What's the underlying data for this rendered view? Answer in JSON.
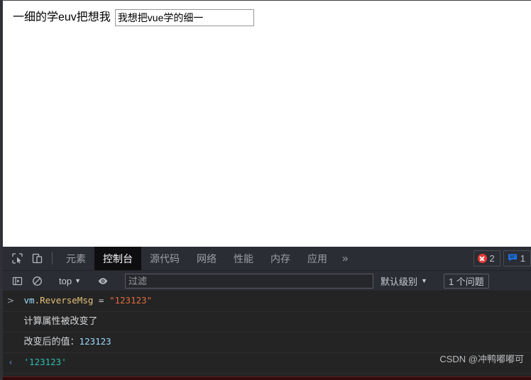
{
  "page": {
    "reversed_text": "一细的学euv把想我",
    "input_value": "我想把vue学的细一",
    "input_placeholder": ""
  },
  "devtools": {
    "icons": {
      "inspect": "inspect-element-icon",
      "device": "device-toolbar-icon",
      "sidebar": "console-sidebar-icon",
      "clear": "clear-console-icon",
      "eye": "live-expression-eye-icon"
    },
    "tabs": [
      {
        "label": "元素",
        "active": false
      },
      {
        "label": "控制台",
        "active": true
      },
      {
        "label": "源代码",
        "active": false
      },
      {
        "label": "网络",
        "active": false
      },
      {
        "label": "性能",
        "active": false
      },
      {
        "label": "内存",
        "active": false
      },
      {
        "label": "应用",
        "active": false
      }
    ],
    "more_tabs_label": "»",
    "badges": {
      "error_count": "2",
      "message_count": "1",
      "error_color": "#e53935",
      "message_color": "#1a73e8"
    },
    "console_toolbar": {
      "context_label": "top",
      "context_caret": "▼",
      "filter_placeholder": "过滤",
      "filter_value": "",
      "levels_label": "默认级别",
      "levels_caret": "▼",
      "issues_label": "1 个问题"
    },
    "console_messages": [
      {
        "gutter": ">",
        "gutter_type": "input",
        "type": "command",
        "tokens": [
          {
            "text": "vm",
            "cls": "tok-obj"
          },
          {
            "text": ".ReverseMsg",
            "cls": "tok-prop"
          },
          {
            "text": " = ",
            "cls": "tok-op"
          },
          {
            "text": "\"123123\"",
            "cls": "tok-str-q"
          }
        ]
      },
      {
        "gutter": "",
        "gutter_type": "none",
        "type": "log",
        "text": "计算属性被改变了"
      },
      {
        "gutter": "",
        "gutter_type": "none",
        "type": "log-mixed",
        "tokens": [
          {
            "text": "改变后的值：",
            "cls": "log-cjk"
          },
          {
            "text": "123123",
            "cls": "tok-num"
          }
        ]
      },
      {
        "gutter": "‹",
        "gutter_type": "output",
        "type": "result",
        "tokens": [
          {
            "text": "'123123'",
            "cls": "tok-ret"
          }
        ]
      }
    ],
    "watermark": "CSDN @冲鸭嘟嘟可"
  }
}
